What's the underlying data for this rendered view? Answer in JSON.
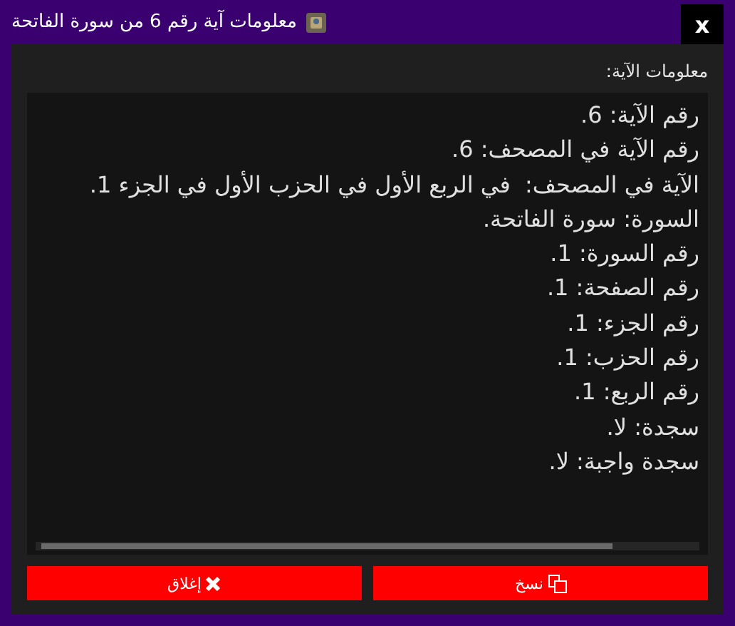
{
  "window": {
    "title": "معلومات آية رقم 6 من سورة الفاتحة",
    "close": "x"
  },
  "info_label": "معلومات الآية:",
  "info_lines": [
    "رقم الآية: 6.",
    "رقم الآية في المصحف: 6.",
    "الآية في المصحف:  في الربع الأول في الحزب الأول في الجزء 1.",
    "السورة: سورة الفاتحة.",
    "رقم السورة: 1.",
    "رقم الصفحة: 1.",
    "رقم الجزء: 1.",
    "رقم الحزب: 1.",
    "رقم الربع: 1.",
    "سجدة: لا.",
    "سجدة واجبة: لا."
  ],
  "buttons": [
    {
      "kind": "copy",
      "label": "نسخ"
    },
    {
      "kind": "close",
      "label": "إغلاق"
    }
  ]
}
